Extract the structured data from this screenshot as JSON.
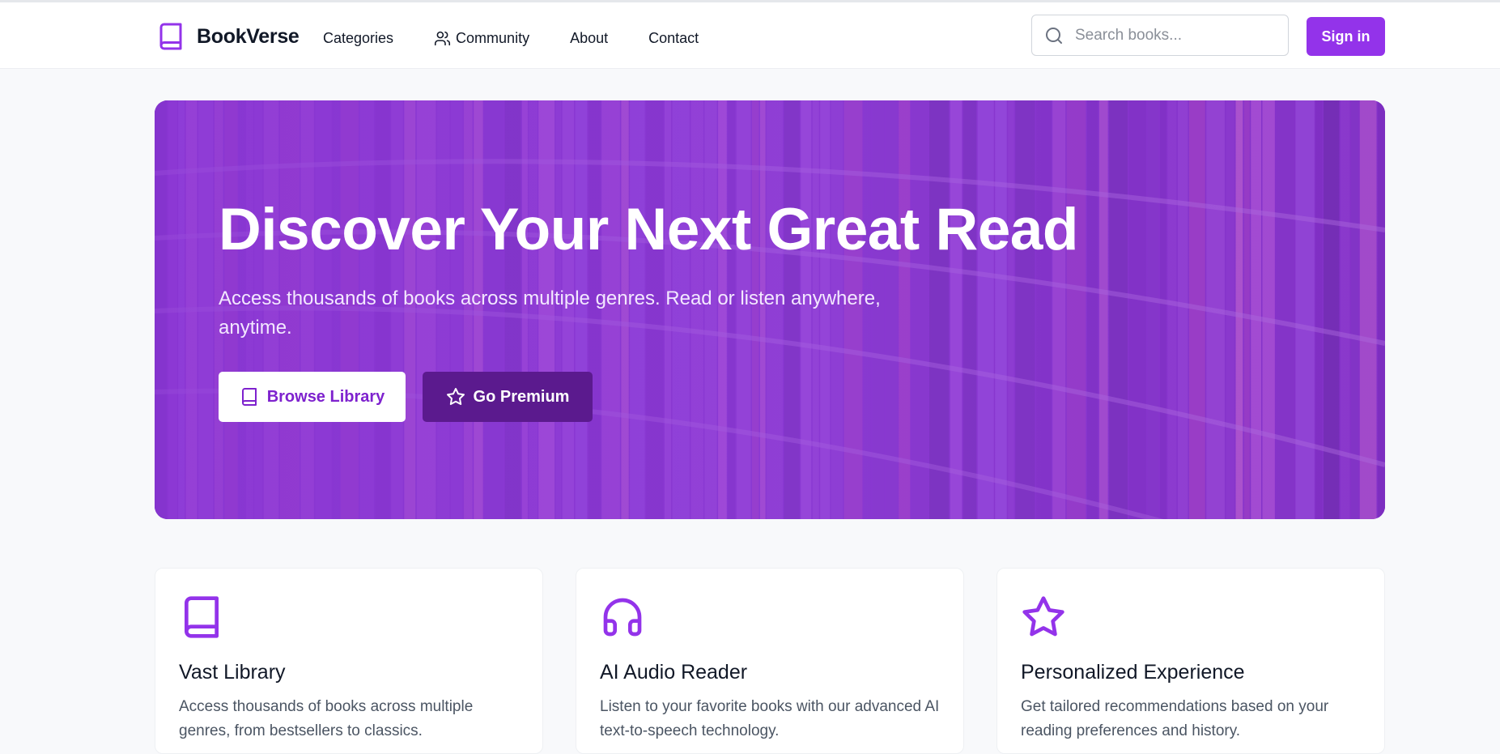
{
  "brand": {
    "name": "BookVerse",
    "accent": "#9333ea"
  },
  "nav": {
    "links": [
      {
        "label": "Categories",
        "icon": null
      },
      {
        "label": "Community",
        "icon": "users-icon"
      },
      {
        "label": "About",
        "icon": null
      },
      {
        "label": "Contact",
        "icon": null
      }
    ],
    "search_placeholder": "Search books...",
    "signin_label": "Sign in"
  },
  "hero": {
    "title": "Discover Your Next Great Read",
    "subtitle": "Access thousands of books across multiple genres. Read or listen anywhere, anytime.",
    "browse_label": "Browse Library",
    "premium_label": "Go Premium",
    "background": "library-bookshelves-image"
  },
  "features": [
    {
      "icon": "book-icon",
      "title": "Vast Library",
      "description": "Access thousands of books across multiple genres, from bestsellers to classics."
    },
    {
      "icon": "headphones-icon",
      "title": "AI Audio Reader",
      "description": "Listen to your favorite books with our advanced AI text-to-speech technology."
    },
    {
      "icon": "star-icon",
      "title": "Personalized Experience",
      "description": "Get tailored recommendations based on your reading preferences and history."
    }
  ]
}
